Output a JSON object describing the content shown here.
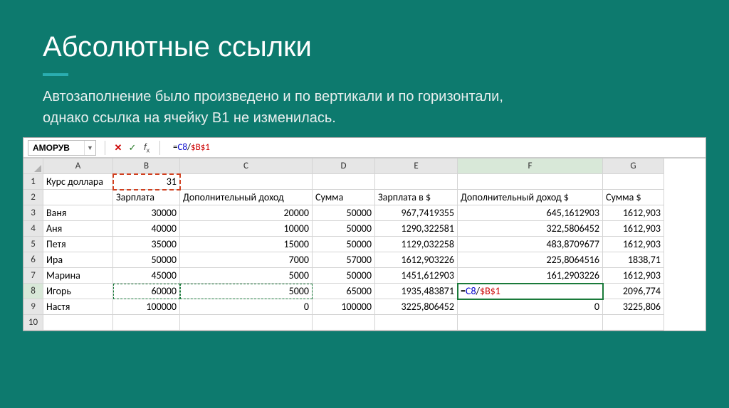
{
  "title": "Абсолютные ссылки",
  "subtitle1": "Автозаполнение было произведено и по вертикали и по горизонтали,",
  "subtitle2": "однако ссылка на ячейку B1 не изменилась.",
  "nameBox": "АМОРУВ",
  "formula": {
    "eq": "=",
    "ref1": "C8",
    "op": "/",
    "ref2": "$B$1"
  },
  "columns": [
    "A",
    "B",
    "C",
    "D",
    "E",
    "F",
    "G"
  ],
  "rows": [
    "1",
    "2",
    "3",
    "4",
    "5",
    "6",
    "7",
    "8",
    "9",
    "10"
  ],
  "cells": {
    "A1": "Курс доллара",
    "B1": "31",
    "B2": "Зарплата",
    "C2": "Дополнительный доход",
    "D2": "Сумма",
    "E2": "Зарплата в $",
    "F2": "Дополнительный доход $",
    "G2": "Сумма $",
    "A3": "Ваня",
    "B3": "30000",
    "C3": "20000",
    "D3": "50000",
    "E3": "967,7419355",
    "F3": "645,1612903",
    "G3": "1612,903",
    "A4": "Аня",
    "B4": "40000",
    "C4": "10000",
    "D4": "50000",
    "E4": "1290,322581",
    "F4": "322,5806452",
    "G4": "1612,903",
    "A5": "Петя",
    "B5": "35000",
    "C5": "15000",
    "D5": "50000",
    "E5": "1129,032258",
    "F5": "483,8709677",
    "G5": "1612,903",
    "A6": "Ира",
    "B6": "50000",
    "C6": "7000",
    "D6": "57000",
    "E6": "1612,903226",
    "F6": "225,8064516",
    "G6": "1838,71",
    "A7": "Марина",
    "B7": "45000",
    "C7": "5000",
    "D7": "50000",
    "E7": "1451,612903",
    "F7": "161,2903226",
    "G7": "1612,903",
    "A8": "Игорь",
    "B8": "60000",
    "C8": "5000",
    "D8": "65000",
    "E8": "1935,483871",
    "G8": "2096,774",
    "A9": "Настя",
    "B9": "100000",
    "C9": "0",
    "D9": "100000",
    "E9": "3225,806452",
    "F9": "0",
    "G9": "3225,806"
  },
  "activeFormula": {
    "eq": "=",
    "ref1": "C8",
    "op": "/",
    "ref2": "$B$1"
  }
}
